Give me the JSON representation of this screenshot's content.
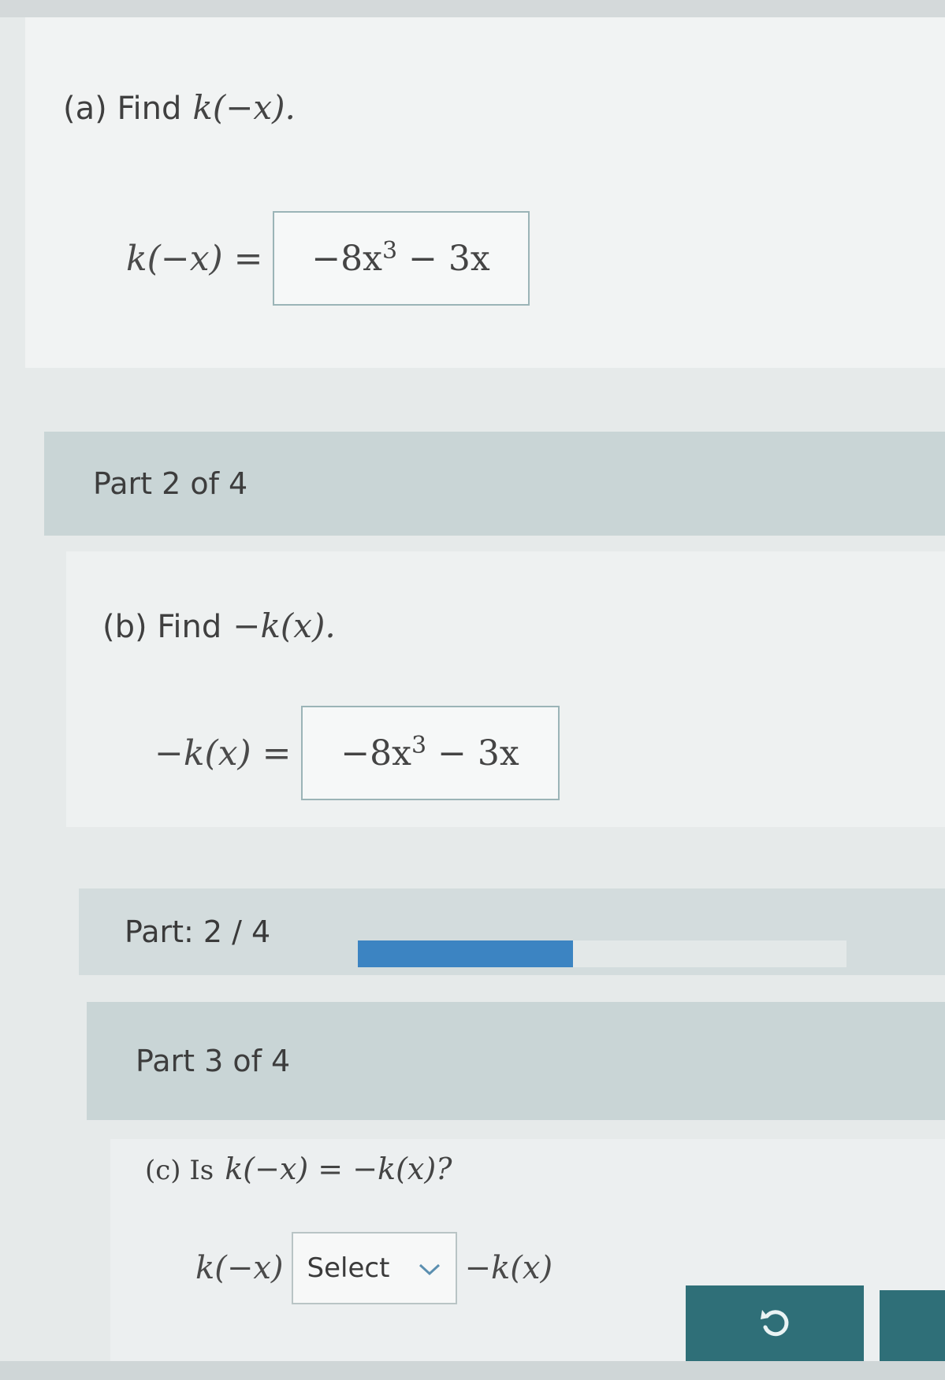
{
  "part_a": {
    "label": "(a) Find",
    "prompt_fn": "k(−x).",
    "lhs": "k(−x) =",
    "answer_coeff": "−8x",
    "answer_exp": "3",
    "answer_rest": " − 3x"
  },
  "part2_header": "Part 2 of 4",
  "part_b": {
    "label": "(b) Find",
    "prompt_fn": "−k(x).",
    "lhs": "−k(x) =",
    "answer_coeff": "−8x",
    "answer_exp": "3",
    "answer_rest": " − 3x"
  },
  "progress": {
    "label": "Part: 2 / 4",
    "fraction": 0.44
  },
  "part3_header": "Part 3 of 4",
  "part_c": {
    "label": "(c) Is",
    "question": "k(−x) = −k(x)?",
    "lhs": "k(−x)",
    "select_value": "Select",
    "rhs": "−k(x)"
  },
  "undo_button": {
    "icon": "undo-icon"
  },
  "colors": {
    "header_bg": "#c9d5d6",
    "progress_fill": "#3c84c2",
    "button_bg": "#2f6f78"
  }
}
